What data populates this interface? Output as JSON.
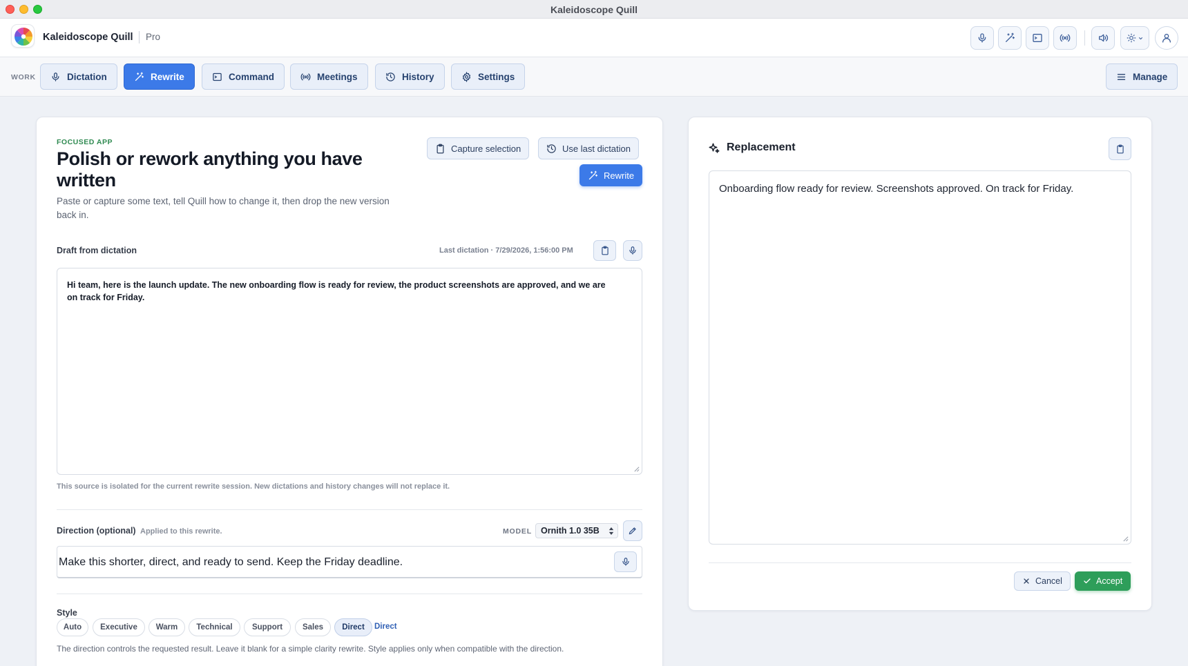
{
  "window": {
    "title": "Kaleidoscope Quill"
  },
  "app": {
    "name": "Kaleidoscope Quill",
    "tier": "Pro"
  },
  "toolbar_icons": [
    "mic-icon",
    "magic-wand-icon",
    "terminal-icon",
    "broadcast-icon",
    "speaker-icon",
    "sun-icon",
    "user-icon"
  ],
  "nav": {
    "section_label": "WORK",
    "items": [
      {
        "label": "Dictation",
        "icon": "mic-icon"
      },
      {
        "label": "Rewrite",
        "icon": "magic-wand-icon",
        "active": true
      },
      {
        "label": "Command",
        "icon": "terminal-icon"
      },
      {
        "label": "Meetings",
        "icon": "broadcast-icon"
      },
      {
        "label": "History",
        "icon": "history-icon"
      },
      {
        "label": "Settings",
        "icon": "gear-icon"
      }
    ],
    "manage_label": "Manage"
  },
  "rewrite": {
    "eyebrow": "FOCUSED APP",
    "title": "Polish or rework anything you have written",
    "subtitle": "Paste or capture some text, tell Quill how to change it, then drop the new version back in.",
    "capture_label": "Capture selection",
    "last_dictation_label": "Use last dictation",
    "rewrite_label": "Rewrite",
    "draft": {
      "label": "Draft from dictation",
      "meta": "Last dictation · 7/29/2026, 1:56:00 PM",
      "text": "Hi team, here is the launch update. The new onboarding flow is ready for review, the product screenshots are approved, and we are on track for Friday.",
      "note": "This source is isolated for the current rewrite session. New dictations and history changes will not replace it."
    },
    "direction": {
      "label": "Direction (optional)",
      "hint": "Applied to this rewrite.",
      "model_label": "MODEL",
      "model_value": "Ornith 1.0 35B",
      "value": "Make this shorter, direct, and ready to send. Keep the Friday deadline."
    },
    "style": {
      "label": "Style",
      "options": [
        "Auto",
        "Executive",
        "Warm",
        "Technical",
        "Support",
        "Sales",
        "Direct"
      ],
      "selected": "Direct",
      "help": "The direction controls the requested result. Leave it blank for a simple clarity rewrite. Style applies only when compatible with the direction."
    }
  },
  "replacement": {
    "title": "Replacement",
    "text": "Onboarding flow ready for review. Screenshots approved. On track for Friday.",
    "cancel_label": "Cancel",
    "accept_label": "Accept"
  },
  "colors": {
    "accent": "#3c7ae8",
    "success": "#2e9e5a",
    "eyebrow": "#2f8a51"
  }
}
